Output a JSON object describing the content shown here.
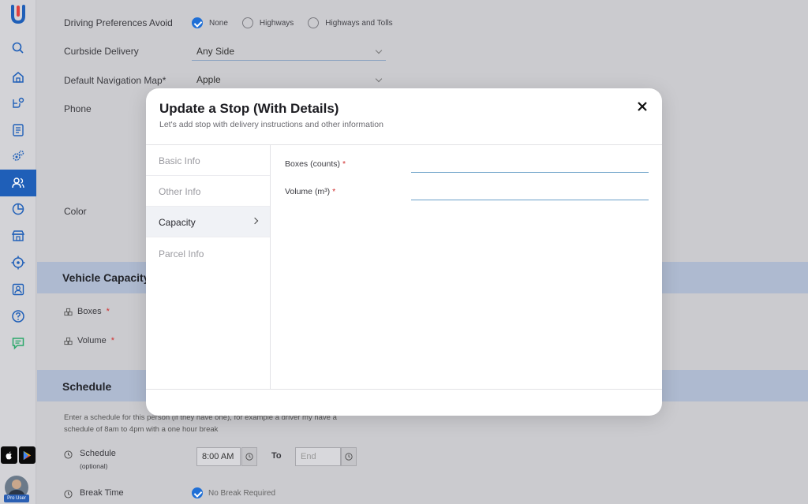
{
  "sidebar": {
    "items": [
      {
        "icon": "search-icon"
      },
      {
        "icon": "home-icon"
      },
      {
        "icon": "route-icon"
      },
      {
        "icon": "checklist-icon"
      },
      {
        "icon": "settings-gears-icon"
      },
      {
        "icon": "people-icon",
        "active": true
      },
      {
        "icon": "pie-chart-icon"
      },
      {
        "icon": "store-icon"
      },
      {
        "icon": "crosshair-icon"
      },
      {
        "icon": "contact-card-icon"
      },
      {
        "icon": "help-icon"
      },
      {
        "icon": "chat-icon"
      }
    ],
    "profile_tag": "Pro User"
  },
  "form": {
    "driving_pref_label": "Driving Preferences Avoid",
    "driving_options": [
      {
        "label": "None",
        "checked": true
      },
      {
        "label": "Highways",
        "checked": false
      },
      {
        "label": "Highways and Tolls",
        "checked": false
      }
    ],
    "curbside_label": "Curbside Delivery",
    "curbside_value": "Any Side",
    "nav_map_label": "Default Navigation Map*",
    "nav_map_value": "Apple",
    "phone_label": "Phone",
    "color_label": "Color",
    "vehicle_capacity_title": "Vehicle Capacity",
    "boxes_label": "Boxes",
    "volume_label": "Volume",
    "required_mark": "*",
    "schedule_title": "Schedule",
    "schedule_desc": "Enter a schedule for this person (if they have one), for example a driver my have a schedule of 8am to 4pm with a one hour break",
    "schedule_label": "Schedule",
    "schedule_optional": "(optional)",
    "start_time": "8:00 AM",
    "to_label": "To",
    "end_placeholder": "End",
    "break_label": "Break Time",
    "no_break_label": "No Break Required"
  },
  "modal": {
    "title": "Update a Stop (With Details)",
    "subtitle": "Let's add stop with delivery instructions and other information",
    "nav": [
      {
        "label": "Basic Info",
        "active": false
      },
      {
        "label": "Other Info",
        "active": false
      },
      {
        "label": "Capacity",
        "active": true
      },
      {
        "label": "Parcel Info",
        "active": false
      }
    ],
    "fields": {
      "boxes_label": "Boxes (counts)",
      "volume_label": "Volume (m³)",
      "required_mark": "*"
    }
  },
  "colors": {
    "accent": "#1f6fd6",
    "active_sidebar": "#1f5fb8",
    "required": "#d03030"
  }
}
